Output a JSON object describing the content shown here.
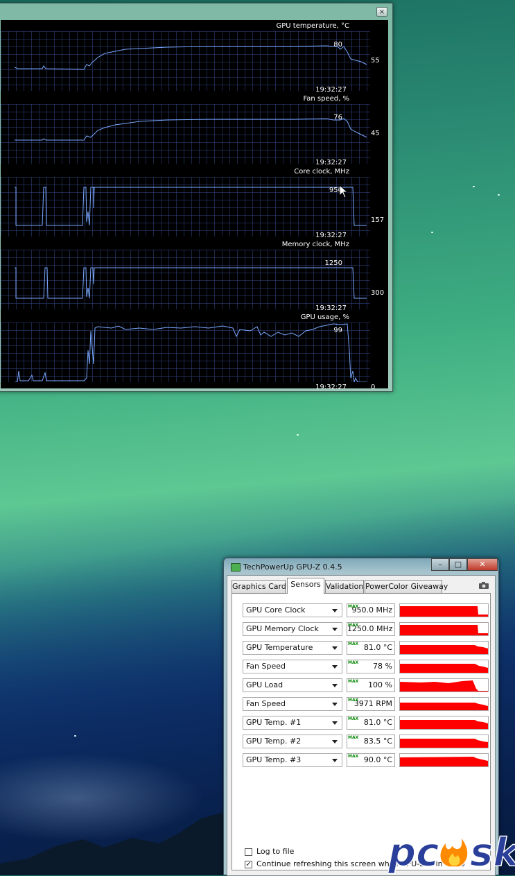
{
  "monitor": {
    "close_label": "×",
    "graphs": [
      {
        "title": "GPU temperature, °C",
        "max_label": "80",
        "current_label": "55",
        "time": "19:32:27"
      },
      {
        "title": "Fan speed, %",
        "max_label": "76",
        "current_label": "45",
        "time": "19:32:27"
      },
      {
        "title": "Core clock, MHz",
        "max_label": "950",
        "current_label": "157",
        "time": "19:32:27"
      },
      {
        "title": "Memory clock, MHz",
        "max_label": "1250",
        "current_label": "300",
        "time": "19:32:27"
      },
      {
        "title": "GPU usage, %",
        "max_label": "99",
        "current_label": "0",
        "time": "19:32:27"
      }
    ]
  },
  "gpuz": {
    "title": "TechPowerUp GPU-Z 0.4.5",
    "window_buttons": {
      "minimize": "–",
      "maximize": "□",
      "close": "✕"
    },
    "tabs": [
      {
        "label": "Graphics Card",
        "active": false
      },
      {
        "label": "Sensors",
        "active": true
      },
      {
        "label": "Validation",
        "active": false
      },
      {
        "label": "PowerColor Giveaway",
        "active": false
      }
    ],
    "max_tag": "MAX",
    "sensors": [
      {
        "name": "GPU Core Clock",
        "value": "950.0 MHz"
      },
      {
        "name": "GPU Memory Clock",
        "value": "1250.0 MHz"
      },
      {
        "name": "GPU Temperature",
        "value": "81.0 °C"
      },
      {
        "name": "Fan Speed",
        "value": "78 %"
      },
      {
        "name": "GPU Load",
        "value": "100 %"
      },
      {
        "name": "Fan Speed",
        "value": "3971 RPM"
      },
      {
        "name": "GPU Temp. #1",
        "value": "81.0 °C"
      },
      {
        "name": "GPU Temp. #2",
        "value": "83.5 °C"
      },
      {
        "name": "GPU Temp. #3",
        "value": "90.0 °C"
      }
    ],
    "options": {
      "log_to_file": {
        "label": "Log to file",
        "checked": false
      },
      "continue_refresh": {
        "label": "Continue refreshing this screen while GPU-Z is in the background",
        "checked": true
      }
    },
    "graph_color": "#ff0000"
  },
  "watermark": {
    "text": "pcask"
  },
  "colors": {
    "graph_line": "#7aa8ff",
    "graph_grid": "#32467e",
    "gpuz_graph": "#ff0000"
  },
  "icons": [
    "close-icon",
    "app-icon",
    "minimize-icon",
    "maximize-icon",
    "camera-icon",
    "dropdown-arrow-icon",
    "mouse-cursor-icon",
    "checkbox-icon"
  ]
}
